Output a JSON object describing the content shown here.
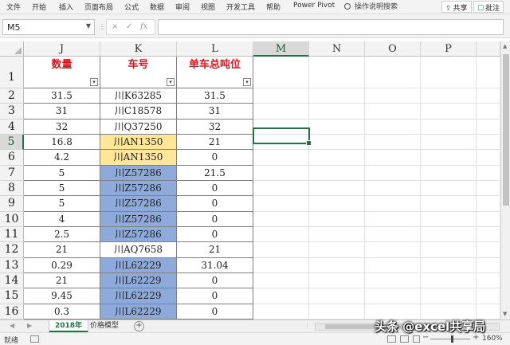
{
  "ribbon": {
    "menus": [
      "文件",
      "开始",
      "插入",
      "页面布局",
      "公式",
      "数据",
      "审阅",
      "视图",
      "开发工具",
      "帮助",
      "Power Pivot"
    ],
    "search_label": "操作说明搜索",
    "share_label": "共享",
    "comment_label": "批注"
  },
  "formula_bar": {
    "name_box": "M5",
    "cancel_glyph": "×",
    "enter_glyph": "✓",
    "fx_label": "fx",
    "formula_value": ""
  },
  "grid": {
    "columns": [
      "J",
      "K",
      "L",
      "M",
      "N",
      "O",
      "P"
    ],
    "active_cell": "M5",
    "header_row": {
      "row": "1",
      "cells": [
        "数量",
        "车号",
        "单车总吨位"
      ]
    },
    "rows": [
      {
        "row": "2",
        "cells": [
          "31.5",
          "川K63285",
          "31.5"
        ],
        "k_fill": "none"
      },
      {
        "row": "3",
        "cells": [
          "31",
          "川C18578",
          "31"
        ],
        "k_fill": "none"
      },
      {
        "row": "4",
        "cells": [
          "32",
          "川Q37250",
          "32"
        ],
        "k_fill": "none"
      },
      {
        "row": "5",
        "cells": [
          "16.8",
          "川AN1350",
          "21"
        ],
        "k_fill": "orange"
      },
      {
        "row": "6",
        "cells": [
          "4.2",
          "川AN1350",
          "0"
        ],
        "k_fill": "orange"
      },
      {
        "row": "7",
        "cells": [
          "5",
          "川Z57286",
          "21.5"
        ],
        "k_fill": "blue"
      },
      {
        "row": "8",
        "cells": [
          "5",
          "川Z57286",
          "0"
        ],
        "k_fill": "blue"
      },
      {
        "row": "9",
        "cells": [
          "5",
          "川Z57286",
          "0"
        ],
        "k_fill": "blue"
      },
      {
        "row": "10",
        "cells": [
          "4",
          "川Z57286",
          "0"
        ],
        "k_fill": "blue"
      },
      {
        "row": "11",
        "cells": [
          "2.5",
          "川Z57286",
          "0"
        ],
        "k_fill": "blue"
      },
      {
        "row": "12",
        "cells": [
          "21",
          "川AQ7658",
          "21"
        ],
        "k_fill": "none"
      },
      {
        "row": "13",
        "cells": [
          "0.29",
          "川L62229",
          "31.04"
        ],
        "k_fill": "blue"
      },
      {
        "row": "14",
        "cells": [
          "21",
          "川L62229",
          "0"
        ],
        "k_fill": "blue"
      },
      {
        "row": "15",
        "cells": [
          "9.45",
          "川L62229",
          "0"
        ],
        "k_fill": "blue"
      },
      {
        "row": "16",
        "cells": [
          "0.3",
          "川L62229",
          "0"
        ],
        "k_fill": "blue"
      }
    ],
    "partial_row_fill": "orange",
    "colors": {
      "header_text": "#e0141e",
      "orange_fill": "#ffe699",
      "blue_fill": "#8eaadb",
      "accent": "#217346"
    }
  },
  "sheets": {
    "tabs": [
      "2018年",
      "价格模型"
    ],
    "active": "2018年",
    "add_glyph": "+"
  },
  "status_bar": {
    "ready": "就绪",
    "zoom_minus": "−",
    "zoom_plus": "+",
    "zoom": "160%"
  },
  "watermark": "头条 @excel共享局"
}
